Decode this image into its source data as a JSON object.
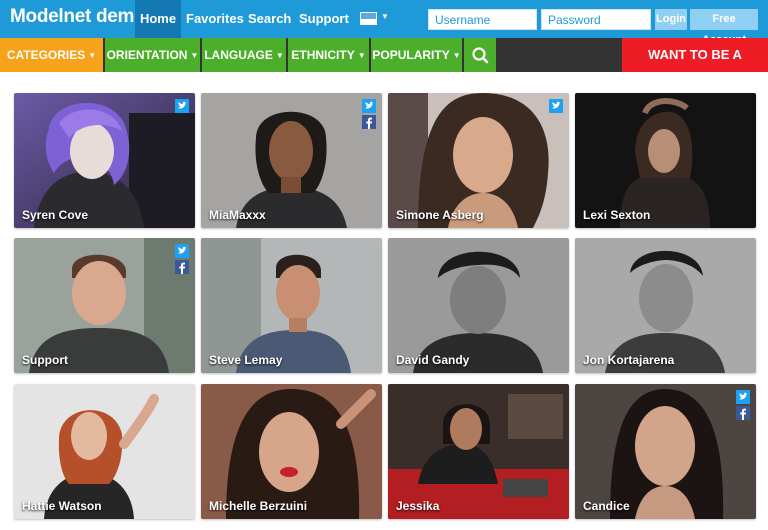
{
  "header": {
    "brand": "Modelnet demo",
    "nav": [
      {
        "label": "Home",
        "active": true
      },
      {
        "label": "Favorites",
        "active": false
      },
      {
        "label": "Search",
        "active": false
      },
      {
        "label": "Support",
        "active": false
      }
    ],
    "language_flag": "flag-icon",
    "username_placeholder": "Username",
    "password_placeholder": "Password",
    "login_label": "Login",
    "free_account_label": "Free Account"
  },
  "filters": {
    "items": [
      {
        "label": "CATEGORIES",
        "color": "#f7a21b"
      },
      {
        "label": "ORIENTATION",
        "color": "#4caf2c"
      },
      {
        "label": "LANGUAGE",
        "color": "#4caf2c"
      },
      {
        "label": "ETHNICITY",
        "color": "#4caf2c"
      },
      {
        "label": "POPULARITY",
        "color": "#4caf2c"
      }
    ],
    "search_icon": "search-icon",
    "cta_label": "WANT TO BE A MODEL?"
  },
  "colors": {
    "top_bar": "#1f9ad9",
    "active_nav": "#1478b3",
    "filter_bar": "#333333",
    "green": "#4caf2c",
    "orange": "#f7a21b",
    "red": "#ee1c25",
    "twitter": "#1da1f2",
    "facebook": "#3b5998"
  },
  "models": [
    {
      "name": "Syren Cove",
      "twitter": true,
      "facebook": false
    },
    {
      "name": "MiaMaxxx",
      "twitter": true,
      "facebook": true
    },
    {
      "name": "Simone Asberg",
      "twitter": true,
      "facebook": false
    },
    {
      "name": "Lexi Sexton",
      "twitter": false,
      "facebook": false
    },
    {
      "name": "Support",
      "twitter": true,
      "facebook": true
    },
    {
      "name": "Steve Lemay",
      "twitter": false,
      "facebook": false
    },
    {
      "name": "David Gandy",
      "twitter": false,
      "facebook": false
    },
    {
      "name": "Jon Kortajarena",
      "twitter": false,
      "facebook": false
    },
    {
      "name": "Hattie Watson",
      "twitter": false,
      "facebook": false
    },
    {
      "name": "Michelle Berzuini",
      "twitter": false,
      "facebook": false
    },
    {
      "name": "Jessika",
      "twitter": false,
      "facebook": false
    },
    {
      "name": "Candice",
      "twitter": true,
      "facebook": true
    }
  ]
}
